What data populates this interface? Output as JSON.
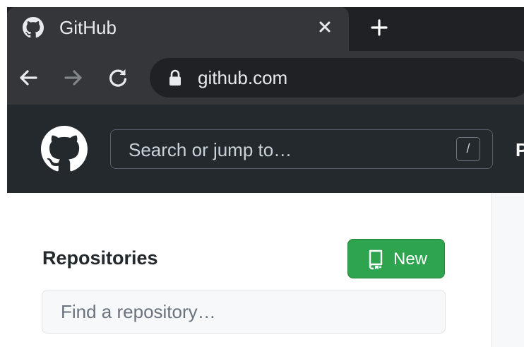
{
  "browser": {
    "tab": {
      "title": "GitHub",
      "favicon": "github-mark-icon"
    },
    "omnibox": {
      "url": "github.com"
    },
    "colors": {
      "tab_strip": "#202124",
      "active_tab": "#35363a",
      "omnibox": "#202124",
      "text": "#e8eaed"
    }
  },
  "header": {
    "logo": "github-octocat-icon",
    "search": {
      "placeholder": "Search or jump to…",
      "shortcut_key": "/"
    },
    "overflow_text": "P",
    "colors": {
      "background": "#24292e"
    }
  },
  "repositories": {
    "title": "Repositories",
    "new_button": {
      "label": "New",
      "icon": "repo-icon",
      "color": "#2ea44f"
    },
    "filter": {
      "placeholder": "Find a repository…"
    }
  }
}
